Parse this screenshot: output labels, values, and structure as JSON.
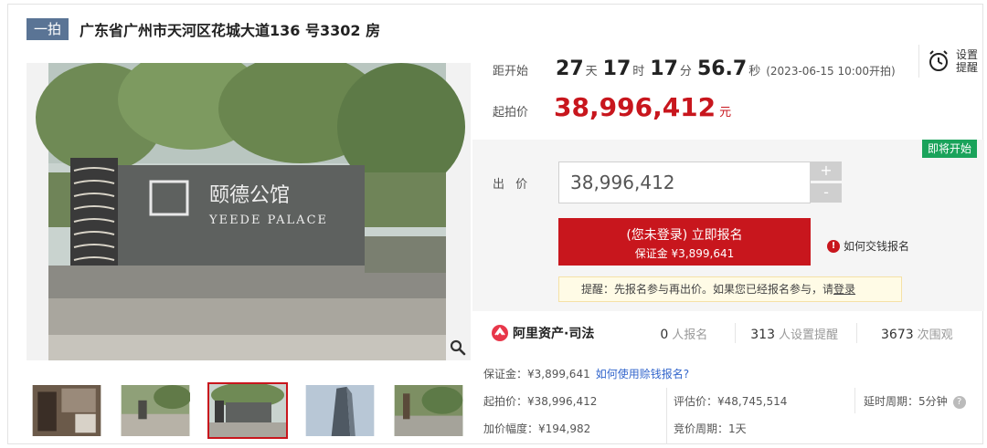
{
  "header": {
    "tag": "一拍",
    "title": "广东省广州市天河区花城大道136 号3302 房"
  },
  "photo": {
    "sign_line1": "颐德公馆",
    "sign_line2": "YEEDE PALACE",
    "zoom_icon": "magnifier-icon"
  },
  "thumbnails": [
    {
      "label": "interior",
      "active": false
    },
    {
      "label": "entrance",
      "active": false
    },
    {
      "label": "sign",
      "active": true
    },
    {
      "label": "tower",
      "active": false
    },
    {
      "label": "garden",
      "active": false
    }
  ],
  "countdown": {
    "label": "距开始",
    "days": "27",
    "days_unit": "天",
    "hours": "17",
    "hours_unit": "时",
    "minutes": "17",
    "minutes_unit": "分",
    "seconds": "56.7",
    "seconds_unit": "秒",
    "start_note": "(2023-06-15 10:00开拍)"
  },
  "reminder": {
    "icon": "alarm-clock-icon",
    "label": "设置提醒"
  },
  "start_price": {
    "label": "起拍价",
    "value": "38,996,412",
    "unit": "元"
  },
  "bid": {
    "badge": "即将开始",
    "label": "出 价",
    "input_value": "38,996,412",
    "plus": "+",
    "minus": "-",
    "signup_main": "(您未登录) 立即报名",
    "signup_sub": "保证金 ¥3,899,641",
    "howto": "如何交钱报名",
    "reminder_prefix": "提醒：先报名参与再出价。如果您已经报名参与，请",
    "reminder_link": "登录"
  },
  "stats": {
    "brand": "阿里资产·司法",
    "signups_num": "0",
    "signups_lbl": "人报名",
    "reminders_num": "313",
    "reminders_lbl": "人设置提醒",
    "views_num": "3673",
    "views_lbl": "次围观"
  },
  "details": {
    "deposit": "保证金：¥3,899,641",
    "deposit_link": "如何使用赊钱报名?",
    "start_price": "起拍价：¥38,996,412",
    "appraisal": "评估价：¥48,745,514",
    "delay_period": "延时周期：5分钟",
    "increment": "加价幅度：¥194,982",
    "bid_period": "竞价周期：1天"
  },
  "colors": {
    "accent_red": "#c8161d",
    "badge_green": "#1aa35b",
    "tag_blue": "#5a7495",
    "link_blue": "#3366cc"
  }
}
